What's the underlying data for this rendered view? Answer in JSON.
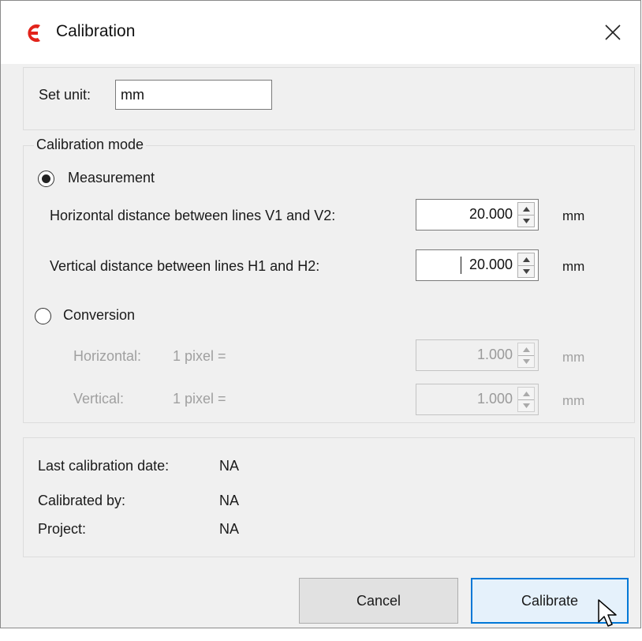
{
  "window": {
    "title": "Calibration",
    "icon": "app-logo-icon",
    "close": "close-icon",
    "accent": "#0078d7",
    "logo_color": "#e2231a"
  },
  "unit_section": {
    "label": "Set unit:",
    "value": "mm"
  },
  "mode": {
    "legend": "Calibration mode",
    "measurement": {
      "label": "Measurement",
      "selected": true,
      "horizontal": {
        "label": "Horizontal distance between lines V1 and V2:",
        "value": "20.000",
        "unit": "mm"
      },
      "vertical": {
        "label": "Vertical distance between lines H1 and H2:",
        "value": "20.000",
        "unit": "mm"
      }
    },
    "conversion": {
      "label": "Conversion",
      "selected": false,
      "horizontal": {
        "label": "Horizontal:",
        "pixel": "1 pixel =",
        "value": "1.000",
        "unit": "mm"
      },
      "vertical": {
        "label": "Vertical:",
        "pixel": "1 pixel =",
        "value": "1.000",
        "unit": "mm"
      }
    }
  },
  "info": {
    "last_date_label": "Last calibration date:",
    "last_date_value": "NA",
    "by_label": "Calibrated by:",
    "by_value": "NA",
    "project_label": "Project:",
    "project_value": "NA"
  },
  "buttons": {
    "cancel": "Cancel",
    "calibrate": "Calibrate"
  }
}
